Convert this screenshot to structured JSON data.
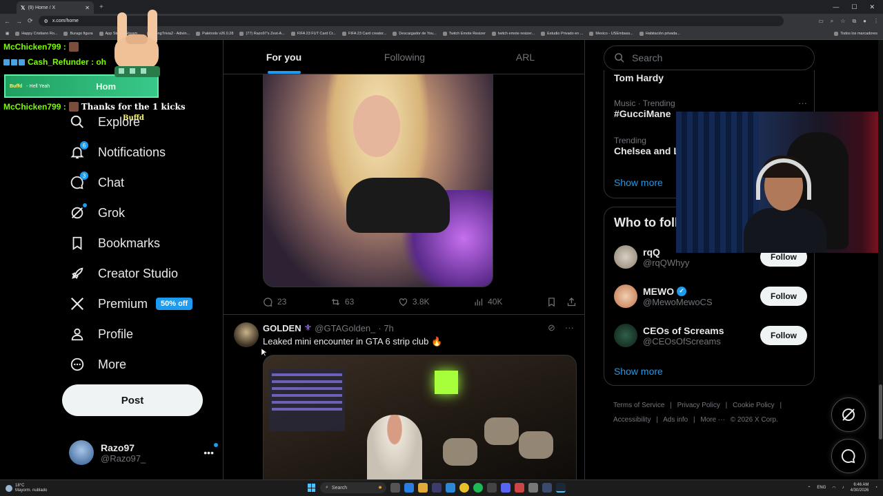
{
  "browser": {
    "tab_title": "(9) Home / X",
    "url": "x.com/home",
    "bookmarks": [
      "Happy Cristiano Ro...",
      "Burago figura",
      "App Store / Stream...",
      "SongTrivia2 - Adivin...",
      "Paletools v26.0.28",
      "(77) Razo97's Zest-A...",
      "FIFA 23 FUT Card Cr...",
      "FIFA 23 Card creator...",
      "Descargador de You...",
      "Twitch Emote Resizer",
      "twitch emote resizer...",
      "Estudio Privado en ...",
      "Mexico - USEmbass...",
      "Habitación privada..."
    ],
    "bookmarks_folder": "Todos los marcadores"
  },
  "chat": {
    "line1_user": "McChicken799 :",
    "line2_user": "Cash_Refunder : oh",
    "banner_user": "Buffd",
    "banner_msg": "- Hell Yeah",
    "line3_user": "McChicken799 :",
    "line3_msg": "Thanks for the 1 kicks",
    "overlay_text": "Buffd",
    "home_label": "Hom"
  },
  "sidebar": {
    "explore": "Explore",
    "notifications": "Notifications",
    "notifications_badge": "6",
    "chat": "Chat",
    "chat_badge": "3",
    "grok": "Grok",
    "bookmarks": "Bookmarks",
    "creator_studio": "Creator Studio",
    "premium": "Premium",
    "premium_badge": "50% off",
    "profile": "Profile",
    "more": "More",
    "post_button": "Post",
    "account_name": "Razo97",
    "account_handle": "@Razo97_"
  },
  "feed": {
    "tabs": [
      "For you",
      "Following",
      "ARL"
    ],
    "post1": {
      "replies": "23",
      "reposts": "63",
      "likes": "3.8K",
      "views": "40K"
    },
    "post2": {
      "name": "GOLDEN",
      "handle": "@GTAGolden_",
      "time": "· 7h",
      "text": "Leaked mini encounter in GTA 6 strip club 🔥"
    }
  },
  "right": {
    "search_placeholder": "Search",
    "trends": [
      {
        "category": "",
        "name": "Tom Hardy"
      },
      {
        "category": "Music · Trending",
        "name": "#GucciMane"
      },
      {
        "category": "Trending",
        "name": "Chelsea and Li"
      }
    ],
    "show_more": "Show more",
    "who_title": "Who to foll",
    "who": [
      {
        "name": "rqQ",
        "handle": "@rqQWhyy",
        "button": "Follow",
        "verified": false
      },
      {
        "name": "MEWO",
        "handle": "@MewoMewoCS",
        "button": "Follow",
        "verified": true
      },
      {
        "name": "CEOs of Screams",
        "handle": "@CEOsOfScreams",
        "button": "Follow",
        "verified": false
      }
    ],
    "who_show_more": "Show more",
    "footer": [
      "Terms of Service",
      "|",
      "Privacy Policy",
      "|",
      "Cookie Policy",
      "|",
      "Accessibility",
      "|",
      "Ads info",
      "|",
      "More ···",
      "© 2026 X Corp."
    ]
  },
  "taskbar": {
    "temperature": "18°C",
    "weather": "Mayorm. nublado",
    "search": "Search",
    "lang": "ENG",
    "time": "6:46 AM",
    "date": "4/30/2026"
  },
  "colors": {
    "accent": "#1d9bf0",
    "background": "#000000",
    "chat_green": "#7CFC00"
  }
}
